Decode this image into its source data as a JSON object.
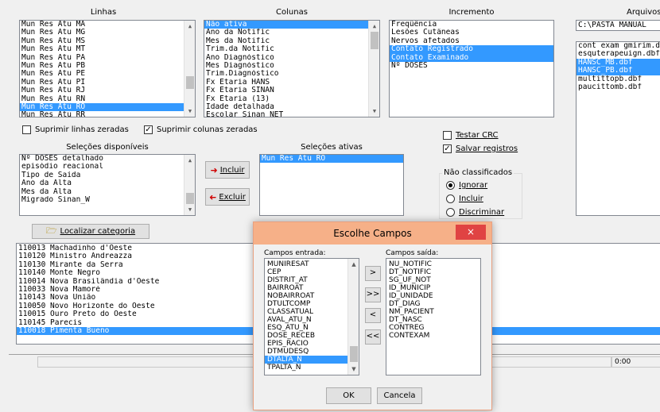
{
  "headers": {
    "linhas": "Linhas",
    "colunas": "Colunas",
    "incremento": "Incremento",
    "arquivos": "Arquivos"
  },
  "linhas_list": [
    "Mun Res Atu MA",
    "Mun Res Atu MG",
    "Mun Res Atu MS",
    "Mun Res Atu MT",
    "Mun Res Atu PA",
    "Mun Res Atu PB",
    "Mun Res Atu PE",
    "Mun Res Atu PI",
    "Mun Res Atu RJ",
    "Mun Res Atu RN",
    "Mun Res Atu RO",
    "Mun Res Atu RR"
  ],
  "colunas_list": [
    "Não ativa",
    "Ano da Notific",
    "Mes da Notific",
    "Trim.da Notific",
    "Ano Diagnóstico",
    "Mes Diagnóstico",
    "Trim.Diagnóstico",
    "Fx Etaria HANS",
    "Fx Etaria SINAN",
    "Fx Etaria (13)",
    "Idade detalhada",
    "Escolar Sinan NET"
  ],
  "incremento_list": [
    "Freqüência",
    "Lesões Cutâneas",
    "Nervos afetados",
    "Contato Registrado",
    "Contato Examinado",
    "Nº DOSES"
  ],
  "arquivo_path": "C:\\PASTA MANUAL",
  "arquivos_list": [
    "cont exam gmirim.dbf",
    "esquterapeuign.dbf",
    "HANSC_MB.dbf",
    "HANSC_PB.dbf",
    "multittopb.dbf",
    "paucittomb.dbf"
  ],
  "options": {
    "suprimir_linhas": "Suprimir linhas zeradas",
    "suprimir_colunas": "Suprimir colunas zeradas",
    "testar_crc": "Testar CRC",
    "salvar_registros": "Salvar registros",
    "check_mark": "✓"
  },
  "selecoes_disponiveis": {
    "label": "Seleções disponíveis",
    "items": [
      "Nº DOSES detalhado",
      "episódio reacional",
      "Tipo de Saída",
      "Ano da Alta",
      "Mes da Alta",
      "Migrado Sinan_W"
    ]
  },
  "selecoes_ativas": {
    "label": "Seleções ativas",
    "items": [
      "Mun Res Atu RO"
    ]
  },
  "buttons": {
    "incluir": "Incluir",
    "excluir": "Excluir",
    "localizar": "Localizar categoria"
  },
  "nao_classificados": {
    "label": "Não classificados",
    "options": [
      "Ignorar",
      "Incluir",
      "Discriminar"
    ]
  },
  "categorias_list": [
    "110013 Machadinho d'Oeste",
    "110120 Ministro Andreazza",
    "110130 Mirante da Serra",
    "110140 Monte Negro",
    "110014 Nova Brasilândia d'Oeste",
    "110033 Nova Mamoré",
    "110143 Nova União",
    "110050 Novo Horizonte do Oeste",
    "110015 Ouro Preto do Oeste",
    "110145 Parecis",
    "110018 Pimenta Bueno"
  ],
  "status": {
    "time": "0:00"
  },
  "dialog": {
    "title": "Escolhe Campos",
    "close": "×",
    "entrada_label": "Campos entrada:",
    "saida_label": "Campos saída:",
    "entrada_list": [
      "MUNIRESAT",
      "CEP",
      "DISTRIT_AT",
      "BAIRROAT",
      "NOBAIRROAT",
      "DTULTCOMP",
      "CLASSATUAL",
      "AVAL_ATU_N",
      "ESQ_ATU_N",
      "DOSE_RECEB",
      "EPIS_RACIO",
      "DTMUDESQ",
      "DTALTA_N",
      "TPALTA_N"
    ],
    "saida_list": [
      "NU_NOTIFIC",
      "DT_NOTIFIC",
      "SG_UF_NOT",
      "ID_MUNICIP",
      "ID_UNIDADE",
      "DT_DIAG",
      "NM_PACIENT",
      "DT_NASC",
      "CONTREG",
      "CONTEXAM"
    ],
    "move_one": ">",
    "move_all": ">>",
    "back_one": "<",
    "back_all": "<<",
    "ok": "OK",
    "cancel": "Cancela"
  }
}
